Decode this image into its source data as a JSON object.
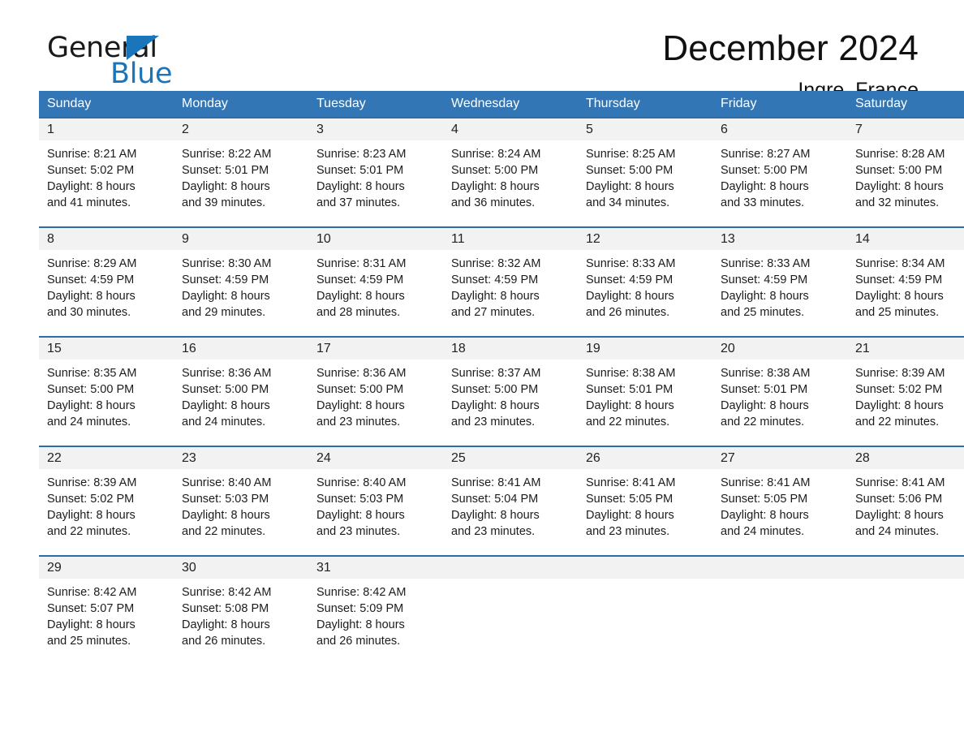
{
  "brand": {
    "name_part1": "General",
    "name_part2": "Blue",
    "accent_color": "#1b75bb"
  },
  "header": {
    "title": "December 2024",
    "location": "Ingre, France"
  },
  "theme": {
    "header_blue": "#3376b6",
    "row_rule_blue": "#2e6da4",
    "daynum_band": "#f2f2f2"
  },
  "calendar": {
    "weekday_headers": [
      "Sunday",
      "Monday",
      "Tuesday",
      "Wednesday",
      "Thursday",
      "Friday",
      "Saturday"
    ],
    "labels": {
      "sunrise_prefix": "Sunrise:",
      "sunset_prefix": "Sunset:",
      "daylight_prefix": "Daylight:"
    },
    "weeks": [
      [
        {
          "day": "1",
          "line1": "Sunrise: 8:21 AM",
          "line2": "Sunset: 5:02 PM",
          "line3": "Daylight: 8 hours",
          "line4": "and 41 minutes."
        },
        {
          "day": "2",
          "line1": "Sunrise: 8:22 AM",
          "line2": "Sunset: 5:01 PM",
          "line3": "Daylight: 8 hours",
          "line4": "and 39 minutes."
        },
        {
          "day": "3",
          "line1": "Sunrise: 8:23 AM",
          "line2": "Sunset: 5:01 PM",
          "line3": "Daylight: 8 hours",
          "line4": "and 37 minutes."
        },
        {
          "day": "4",
          "line1": "Sunrise: 8:24 AM",
          "line2": "Sunset: 5:00 PM",
          "line3": "Daylight: 8 hours",
          "line4": "and 36 minutes."
        },
        {
          "day": "5",
          "line1": "Sunrise: 8:25 AM",
          "line2": "Sunset: 5:00 PM",
          "line3": "Daylight: 8 hours",
          "line4": "and 34 minutes."
        },
        {
          "day": "6",
          "line1": "Sunrise: 8:27 AM",
          "line2": "Sunset: 5:00 PM",
          "line3": "Daylight: 8 hours",
          "line4": "and 33 minutes."
        },
        {
          "day": "7",
          "line1": "Sunrise: 8:28 AM",
          "line2": "Sunset: 5:00 PM",
          "line3": "Daylight: 8 hours",
          "line4": "and 32 minutes."
        }
      ],
      [
        {
          "day": "8",
          "line1": "Sunrise: 8:29 AM",
          "line2": "Sunset: 4:59 PM",
          "line3": "Daylight: 8 hours",
          "line4": "and 30 minutes."
        },
        {
          "day": "9",
          "line1": "Sunrise: 8:30 AM",
          "line2": "Sunset: 4:59 PM",
          "line3": "Daylight: 8 hours",
          "line4": "and 29 minutes."
        },
        {
          "day": "10",
          "line1": "Sunrise: 8:31 AM",
          "line2": "Sunset: 4:59 PM",
          "line3": "Daylight: 8 hours",
          "line4": "and 28 minutes."
        },
        {
          "day": "11",
          "line1": "Sunrise: 8:32 AM",
          "line2": "Sunset: 4:59 PM",
          "line3": "Daylight: 8 hours",
          "line4": "and 27 minutes."
        },
        {
          "day": "12",
          "line1": "Sunrise: 8:33 AM",
          "line2": "Sunset: 4:59 PM",
          "line3": "Daylight: 8 hours",
          "line4": "and 26 minutes."
        },
        {
          "day": "13",
          "line1": "Sunrise: 8:33 AM",
          "line2": "Sunset: 4:59 PM",
          "line3": "Daylight: 8 hours",
          "line4": "and 25 minutes."
        },
        {
          "day": "14",
          "line1": "Sunrise: 8:34 AM",
          "line2": "Sunset: 4:59 PM",
          "line3": "Daylight: 8 hours",
          "line4": "and 25 minutes."
        }
      ],
      [
        {
          "day": "15",
          "line1": "Sunrise: 8:35 AM",
          "line2": "Sunset: 5:00 PM",
          "line3": "Daylight: 8 hours",
          "line4": "and 24 minutes."
        },
        {
          "day": "16",
          "line1": "Sunrise: 8:36 AM",
          "line2": "Sunset: 5:00 PM",
          "line3": "Daylight: 8 hours",
          "line4": "and 24 minutes."
        },
        {
          "day": "17",
          "line1": "Sunrise: 8:36 AM",
          "line2": "Sunset: 5:00 PM",
          "line3": "Daylight: 8 hours",
          "line4": "and 23 minutes."
        },
        {
          "day": "18",
          "line1": "Sunrise: 8:37 AM",
          "line2": "Sunset: 5:00 PM",
          "line3": "Daylight: 8 hours",
          "line4": "and 23 minutes."
        },
        {
          "day": "19",
          "line1": "Sunrise: 8:38 AM",
          "line2": "Sunset: 5:01 PM",
          "line3": "Daylight: 8 hours",
          "line4": "and 22 minutes."
        },
        {
          "day": "20",
          "line1": "Sunrise: 8:38 AM",
          "line2": "Sunset: 5:01 PM",
          "line3": "Daylight: 8 hours",
          "line4": "and 22 minutes."
        },
        {
          "day": "21",
          "line1": "Sunrise: 8:39 AM",
          "line2": "Sunset: 5:02 PM",
          "line3": "Daylight: 8 hours",
          "line4": "and 22 minutes."
        }
      ],
      [
        {
          "day": "22",
          "line1": "Sunrise: 8:39 AM",
          "line2": "Sunset: 5:02 PM",
          "line3": "Daylight: 8 hours",
          "line4": "and 22 minutes."
        },
        {
          "day": "23",
          "line1": "Sunrise: 8:40 AM",
          "line2": "Sunset: 5:03 PM",
          "line3": "Daylight: 8 hours",
          "line4": "and 22 minutes."
        },
        {
          "day": "24",
          "line1": "Sunrise: 8:40 AM",
          "line2": "Sunset: 5:03 PM",
          "line3": "Daylight: 8 hours",
          "line4": "and 23 minutes."
        },
        {
          "day": "25",
          "line1": "Sunrise: 8:41 AM",
          "line2": "Sunset: 5:04 PM",
          "line3": "Daylight: 8 hours",
          "line4": "and 23 minutes."
        },
        {
          "day": "26",
          "line1": "Sunrise: 8:41 AM",
          "line2": "Sunset: 5:05 PM",
          "line3": "Daylight: 8 hours",
          "line4": "and 23 minutes."
        },
        {
          "day": "27",
          "line1": "Sunrise: 8:41 AM",
          "line2": "Sunset: 5:05 PM",
          "line3": "Daylight: 8 hours",
          "line4": "and 24 minutes."
        },
        {
          "day": "28",
          "line1": "Sunrise: 8:41 AM",
          "line2": "Sunset: 5:06 PM",
          "line3": "Daylight: 8 hours",
          "line4": "and 24 minutes."
        }
      ],
      [
        {
          "day": "29",
          "line1": "Sunrise: 8:42 AM",
          "line2": "Sunset: 5:07 PM",
          "line3": "Daylight: 8 hours",
          "line4": "and 25 minutes."
        },
        {
          "day": "30",
          "line1": "Sunrise: 8:42 AM",
          "line2": "Sunset: 5:08 PM",
          "line3": "Daylight: 8 hours",
          "line4": "and 26 minutes."
        },
        {
          "day": "31",
          "line1": "Sunrise: 8:42 AM",
          "line2": "Sunset: 5:09 PM",
          "line3": "Daylight: 8 hours",
          "line4": "and 26 minutes."
        },
        {
          "day": "",
          "line1": "",
          "line2": "",
          "line3": "",
          "line4": ""
        },
        {
          "day": "",
          "line1": "",
          "line2": "",
          "line3": "",
          "line4": ""
        },
        {
          "day": "",
          "line1": "",
          "line2": "",
          "line3": "",
          "line4": ""
        },
        {
          "day": "",
          "line1": "",
          "line2": "",
          "line3": "",
          "line4": ""
        }
      ]
    ]
  }
}
